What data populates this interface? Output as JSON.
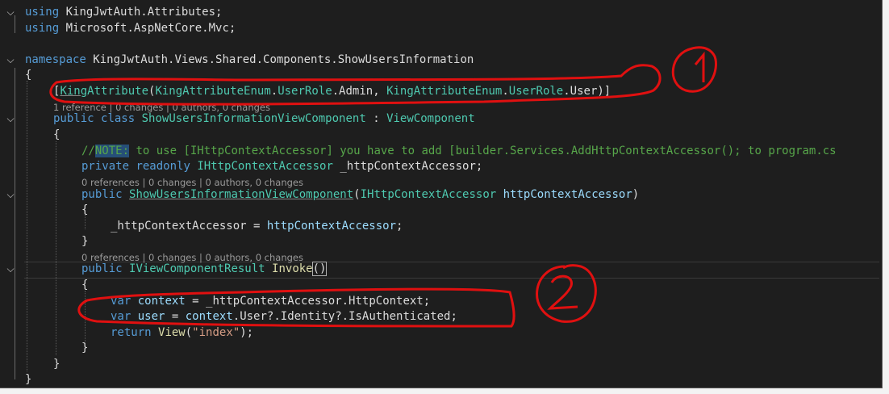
{
  "colors": {
    "background": "#1e1e1e",
    "keyword": "#569cd6",
    "type": "#4ec9b0",
    "method": "#dcdcaa",
    "variable": "#9cdcfe",
    "comment": "#57a64a",
    "string": "#d69d85",
    "annotation": "#e01010"
  },
  "lines": {
    "l1": {
      "kw": "using",
      "name": "KingJwtAuth.Attributes;"
    },
    "l2": {
      "kw": "using",
      "name": "Microsoft.AspNetCore.Mvc;"
    },
    "l3": {
      "kw": "namespace",
      "name": "KingJwtAuth.Views.Shared.Components.ShowUsersInformation"
    },
    "l4": {
      "brace": "{"
    },
    "l5": {
      "open": "[",
      "attr_prefix": "King",
      "attr_rest": "Attribute",
      "paren": "(",
      "enum1": "KingAttributeEnum",
      "dot1": ".",
      "member1": "UserRole",
      "dot2": ".Admin, ",
      "enum2": "KingAttributeEnum",
      "dot3": ".",
      "member2": "UserRole",
      "tail": ".User)]"
    },
    "lens1": "1 reference | 0 changes | 0 authors, 0 changes",
    "l6": {
      "kw1": "public",
      "kw2": "class",
      "cls": "ShowUsersInformationViewComponent",
      "colon": " : ",
      "base": "ViewComponent"
    },
    "l7": {
      "brace": "{"
    },
    "l8": {
      "slashes": "//",
      "note": "NOTE:",
      "text": " to use [IHttpContextAccessor] you have to add [builder.Services.AddHttpContextAccessor(); to program.cs"
    },
    "l9": {
      "kw1": "private",
      "kw2": "readonly",
      "type": "IHttpContextAccessor",
      "field": " _httpContextAccessor;"
    },
    "lens2": "0 references | 0 changes | 0 authors, 0 changes",
    "l10": {
      "kw": "public",
      "ctor": "ShowUsersInformationViewComponent",
      "open": "(",
      "ptype": "IHttpContextAccessor",
      "pname": "httpContextAccessor",
      "close": ")"
    },
    "l11": {
      "brace": "{"
    },
    "l12": {
      "field": "_httpContextAccessor",
      "eq": " = ",
      "value": "httpContextAccessor",
      "semi": ";"
    },
    "l13": {
      "brace": "}"
    },
    "lens3": "0 references | 0 changes | 0 authors, 0 changes",
    "l14": {
      "kw": "public",
      "rtype": "IViewComponentResult",
      "method": "Invoke",
      "parens": "()"
    },
    "l15": {
      "brace": "{"
    },
    "l16": {
      "kw": "var",
      "name": "context",
      "eq": " = ",
      "rhs": "_httpContextAccessor.HttpContext;"
    },
    "l17": {
      "kw": "var",
      "name": "user",
      "eq": " = ",
      "v": "context",
      "rhs": ".User?.Identity?.IsAuthenticated;"
    },
    "l18": {
      "kw": "return",
      "method": "View",
      "open": "(",
      "str": "\"index\"",
      "close": ");"
    },
    "l19": {
      "brace": "}"
    },
    "l20": {
      "brace": "}"
    },
    "l21": {
      "brace": "}"
    }
  },
  "fold_icons": [
    "chevron-down-icon"
  ]
}
